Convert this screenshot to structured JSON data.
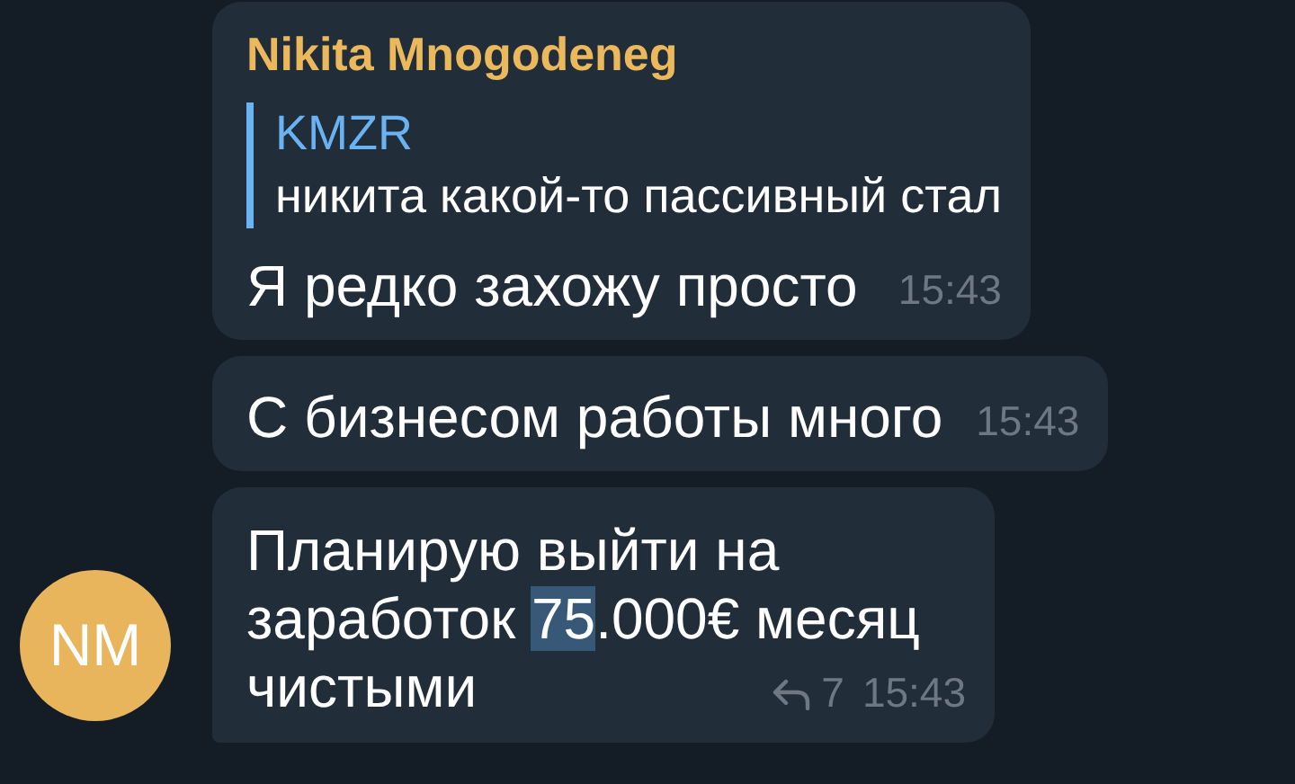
{
  "messages": [
    {
      "sender": "Nikita Mnogodeneg",
      "reply": {
        "author": "KMZR",
        "text": "никита какой-то пассивный стал"
      },
      "text_parts": [
        {
          "text": "Я редко захожу просто",
          "selected": false
        }
      ],
      "time": "15:43"
    },
    {
      "text_parts": [
        {
          "text": "С бизнесом работы много",
          "selected": false
        }
      ],
      "time": "15:43"
    },
    {
      "text_parts": [
        {
          "text": "Планирую выйти на заработок ",
          "selected": false
        },
        {
          "text": "75",
          "selected": true
        },
        {
          "text": ".000€ месяц чистыми",
          "selected": false
        }
      ],
      "replies": "7",
      "time": "15:43"
    }
  ],
  "avatar": {
    "initials": "NM"
  }
}
